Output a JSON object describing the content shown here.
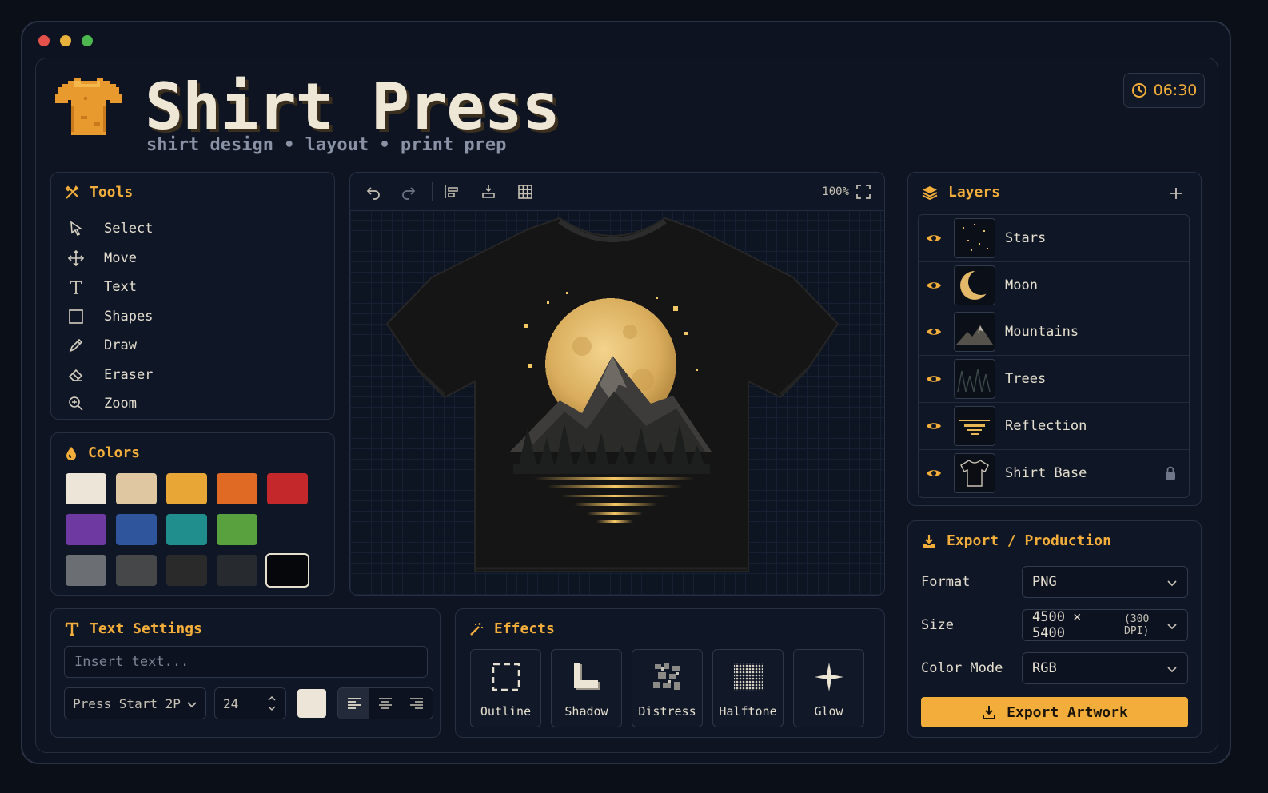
{
  "app": {
    "title": "Shirt Press",
    "subtitle": "shirt design • layout • print prep",
    "timer": "06:30"
  },
  "window": {
    "dots": [
      "#e4514a",
      "#e8b13c",
      "#4cb84f"
    ]
  },
  "tools": {
    "title": "Tools",
    "items": [
      {
        "label": "Select",
        "icon": "cursor-icon"
      },
      {
        "label": "Move",
        "icon": "move-icon"
      },
      {
        "label": "Text",
        "icon": "text-icon"
      },
      {
        "label": "Shapes",
        "icon": "square-icon"
      },
      {
        "label": "Draw",
        "icon": "pencil-icon"
      },
      {
        "label": "Eraser",
        "icon": "eraser-icon"
      },
      {
        "label": "Zoom",
        "icon": "zoom-icon"
      }
    ]
  },
  "colors": {
    "title": "Colors",
    "swatches": [
      "#ede6d8",
      "#dfc7a2",
      "#e7a636",
      "#e06a24",
      "#c5282b",
      "#6e3aa1",
      "#2f569c",
      "#1f8e8d",
      "#58a13e",
      "",
      "#6b6e72",
      "#454749",
      "#2a2a2b",
      "#272b30",
      "#05070b"
    ],
    "selected_index": 14
  },
  "canvas": {
    "zoom": "100%"
  },
  "layers": {
    "title": "Layers",
    "items": [
      {
        "name": "Stars",
        "locked": false
      },
      {
        "name": "Moon",
        "locked": false
      },
      {
        "name": "Mountains",
        "locked": false
      },
      {
        "name": "Trees",
        "locked": false
      },
      {
        "name": "Reflection",
        "locked": false
      },
      {
        "name": "Shirt Base",
        "locked": true
      }
    ]
  },
  "export": {
    "title": "Export / Production",
    "format_label": "Format",
    "format_value": "PNG",
    "size_label": "Size",
    "size_value": "4500 × 5400",
    "size_dpi": "(300 DPI)",
    "mode_label": "Color Mode",
    "mode_value": "RGB",
    "button_label": "Export Artwork"
  },
  "text_settings": {
    "title": "Text Settings",
    "placeholder": "Insert text...",
    "font": "Press Start 2P",
    "size": "24",
    "color": "#ede6d8"
  },
  "effects": {
    "title": "Effects",
    "items": [
      {
        "label": "Outline"
      },
      {
        "label": "Shadow"
      },
      {
        "label": "Distress"
      },
      {
        "label": "Halftone"
      },
      {
        "label": "Glow"
      }
    ]
  },
  "accent": "#f2ad3a"
}
